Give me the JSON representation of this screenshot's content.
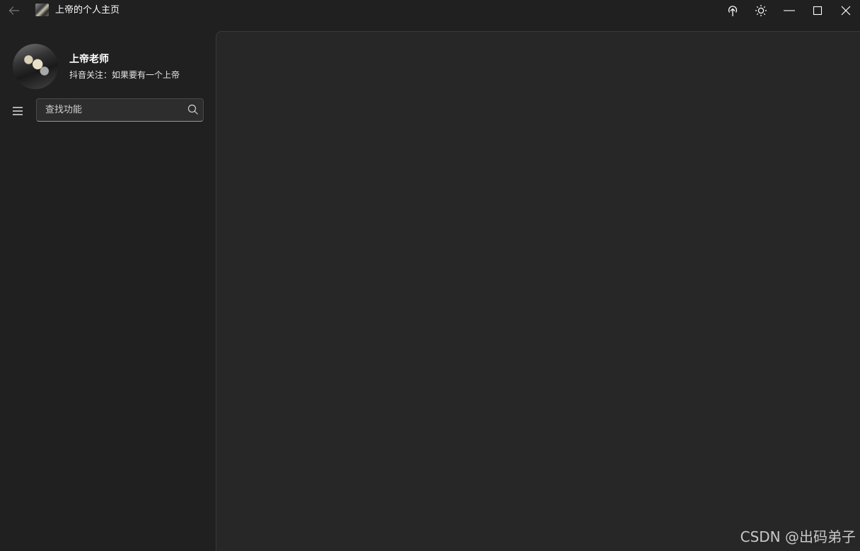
{
  "window": {
    "title": "上帝的个人主页"
  },
  "titlebar": {
    "back_icon": "arrow-left-icon",
    "upload_icon": "upload-icon",
    "theme_icon": "sun-icon",
    "minimize_icon": "minimize-icon",
    "maximize_icon": "maximize-icon",
    "close_icon": "close-icon"
  },
  "profile": {
    "name": "上帝老师",
    "subtitle": "抖音关注：如果要有一个上帝"
  },
  "search": {
    "placeholder": "查找功能",
    "value": ""
  },
  "watermark": "CSDN @出码弟子",
  "colors": {
    "background": "#202020",
    "content_pane": "#272727",
    "text": "#ffffff"
  }
}
